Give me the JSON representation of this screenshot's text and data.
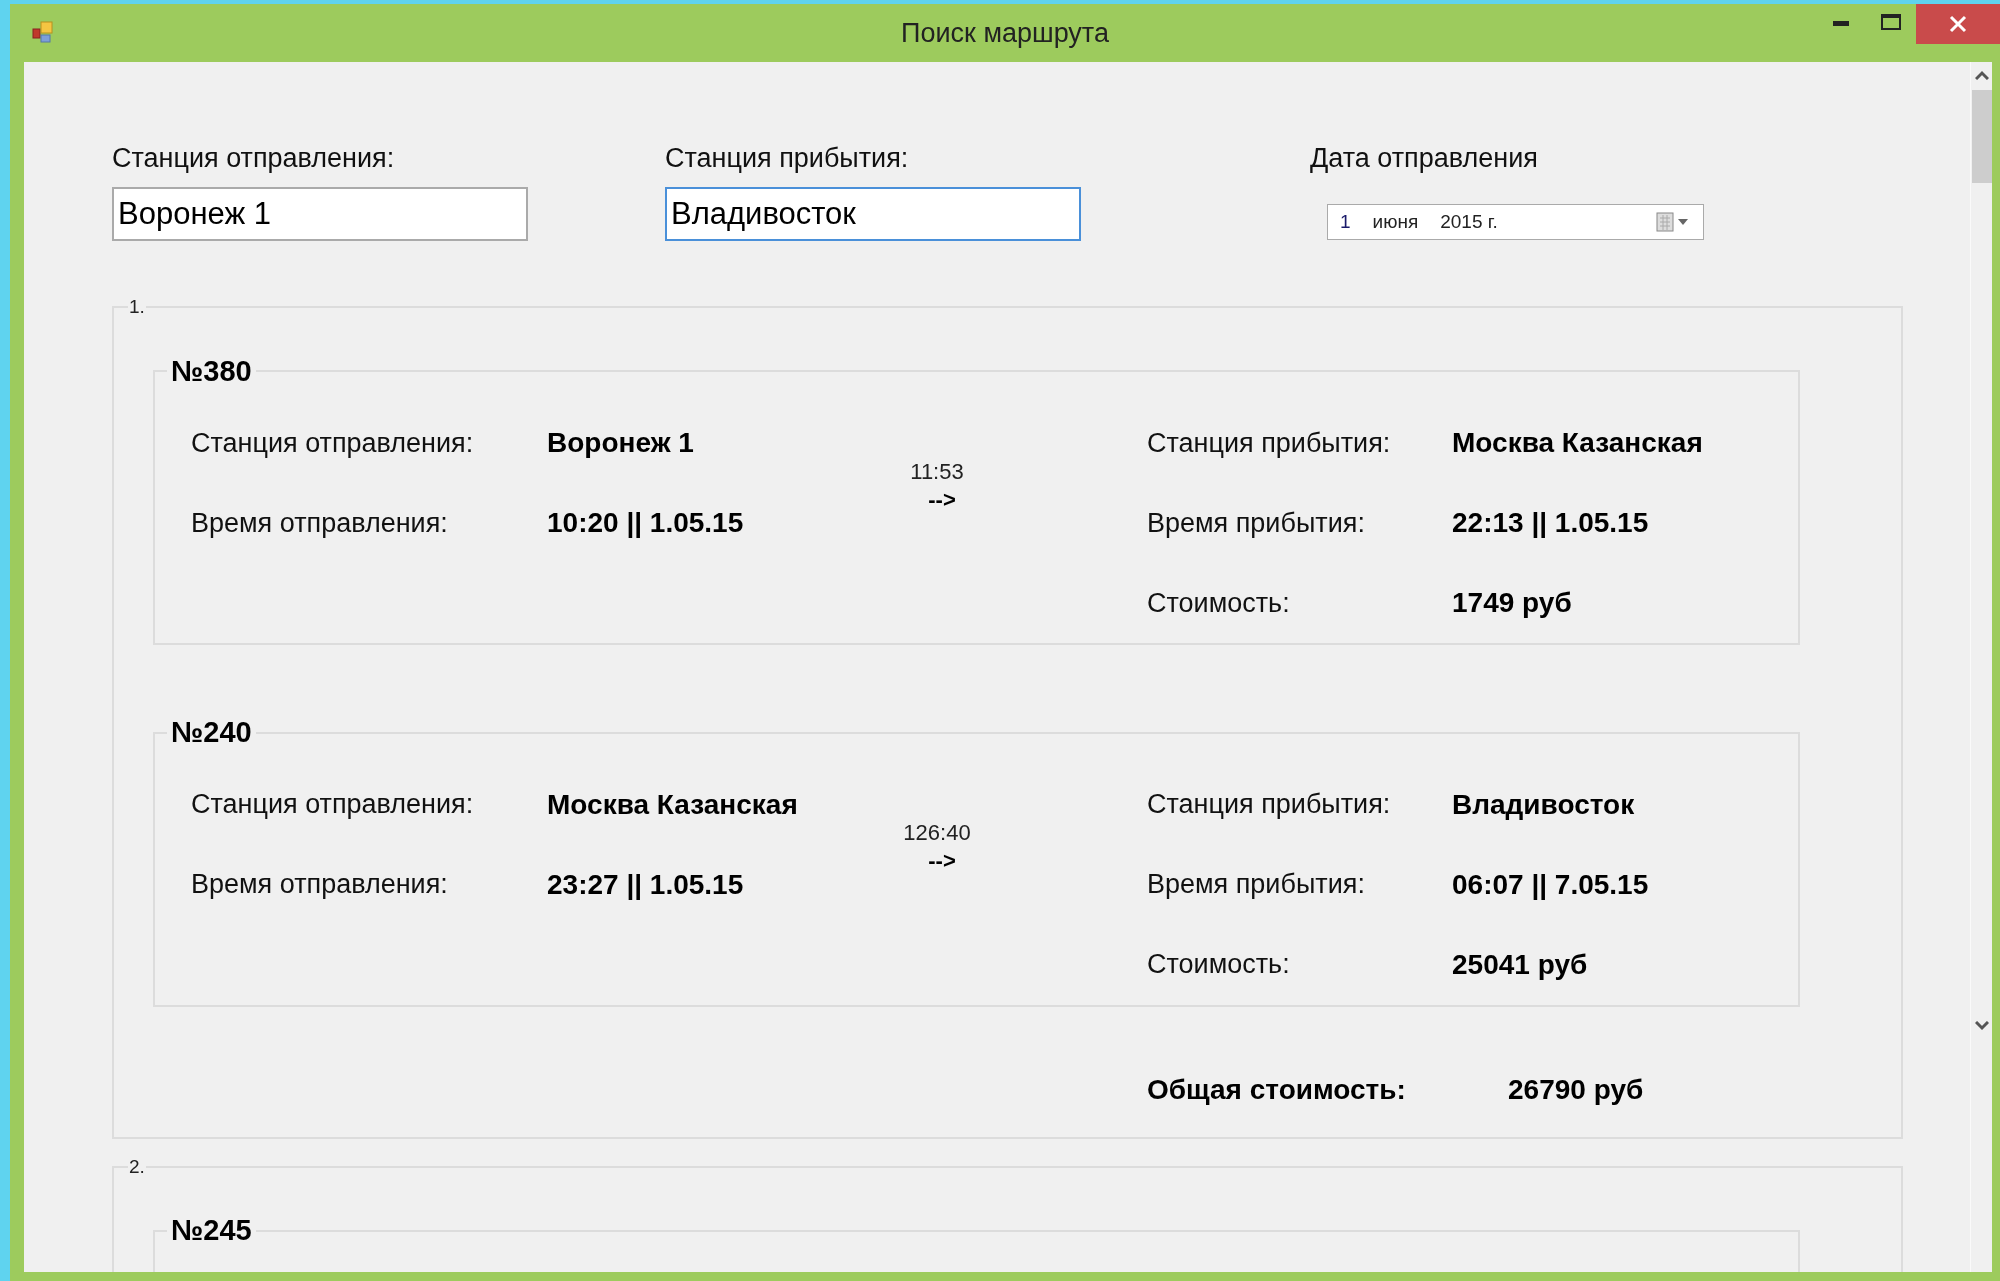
{
  "window": {
    "title": "Поиск маршрута"
  },
  "fields": [
    {
      "label": "Станция отправления:",
      "value": "Воронеж 1",
      "focused": false
    },
    {
      "label": "Станция прибытия:",
      "value": "Владивосток",
      "focused": true
    }
  ],
  "date": {
    "label": "Дата отправления",
    "day": "1",
    "month": "июня",
    "year": "2015 г."
  },
  "routes": [
    {
      "number": "1.",
      "total_label": "Общая стоимость:",
      "total_value": "26790 руб",
      "trains": [
        {
          "number": "№380",
          "dep_label": "Станция отправления:",
          "dep_value": "Воронеж 1",
          "dep_time_label": "Время отправления:",
          "dep_time": "10:20 || 1.05.15",
          "duration": "11:53",
          "arrow": "-->",
          "arr_label": "Станция прибытия:",
          "arr_value": "Москва Казанская",
          "arr_time_label": "Время прибытия:",
          "arr_time": "22:13 || 1.05.15",
          "cost_label": "Стоимость:",
          "cost": "1749 руб"
        },
        {
          "number": "№240",
          "dep_label": "Станция отправления:",
          "dep_value": "Москва Казанская",
          "dep_time_label": "Время отправления:",
          "dep_time": "23:27 || 1.05.15",
          "duration": "126:40",
          "arrow": "-->",
          "arr_label": "Станция прибытия:",
          "arr_value": "Владивосток",
          "arr_time_label": "Время прибытия:",
          "arr_time": "06:07 || 7.05.15",
          "cost_label": "Стоимость:",
          "cost": "25041 руб"
        }
      ]
    },
    {
      "number": "2.",
      "trains": [
        {
          "number": "№245"
        }
      ]
    }
  ]
}
